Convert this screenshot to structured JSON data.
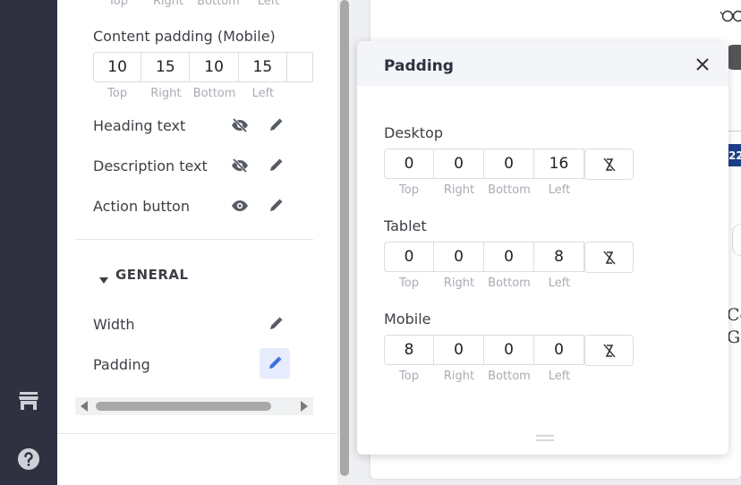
{
  "settings": {
    "top_row_sublabels": [
      "Top",
      "Right",
      "Bottom",
      "Left"
    ],
    "mobile_padding": {
      "label": "Content padding (Mobile)",
      "values": [
        "10",
        "15",
        "10",
        "15"
      ],
      "sublabels": [
        "Top",
        "Right",
        "Bottom",
        "Left"
      ]
    },
    "visibility_items": [
      {
        "label": "Heading text",
        "visibility_icon": "eye-off-icon"
      },
      {
        "label": "Description text",
        "visibility_icon": "eye-off-icon"
      },
      {
        "label": "Action button",
        "visibility_icon": "eye-icon"
      }
    ],
    "general": {
      "title": "GENERAL",
      "items": [
        {
          "label": "Width"
        },
        {
          "label": "Padding"
        }
      ]
    }
  },
  "rail": {
    "icons": [
      "store-icon",
      "help-icon"
    ]
  },
  "popup": {
    "title": "Padding",
    "sections": [
      {
        "label": "Desktop",
        "values": [
          "0",
          "0",
          "0",
          "16"
        ]
      },
      {
        "label": "Tablet",
        "values": [
          "0",
          "0",
          "0",
          "8"
        ]
      },
      {
        "label": "Mobile",
        "values": [
          "8",
          "0",
          "0",
          "0"
        ]
      }
    ],
    "sublabels": [
      "Top",
      "Right",
      "Bottom",
      "Left"
    ]
  },
  "preview": {
    "badge_text": "22",
    "serif_lines": [
      "Co",
      "Gr"
    ]
  },
  "colors": {
    "rail_bg": "#2f3140",
    "accent": "#3b6fe0",
    "active_bg": "#e6ecfb",
    "badge_bg": "#1d3f8a"
  }
}
